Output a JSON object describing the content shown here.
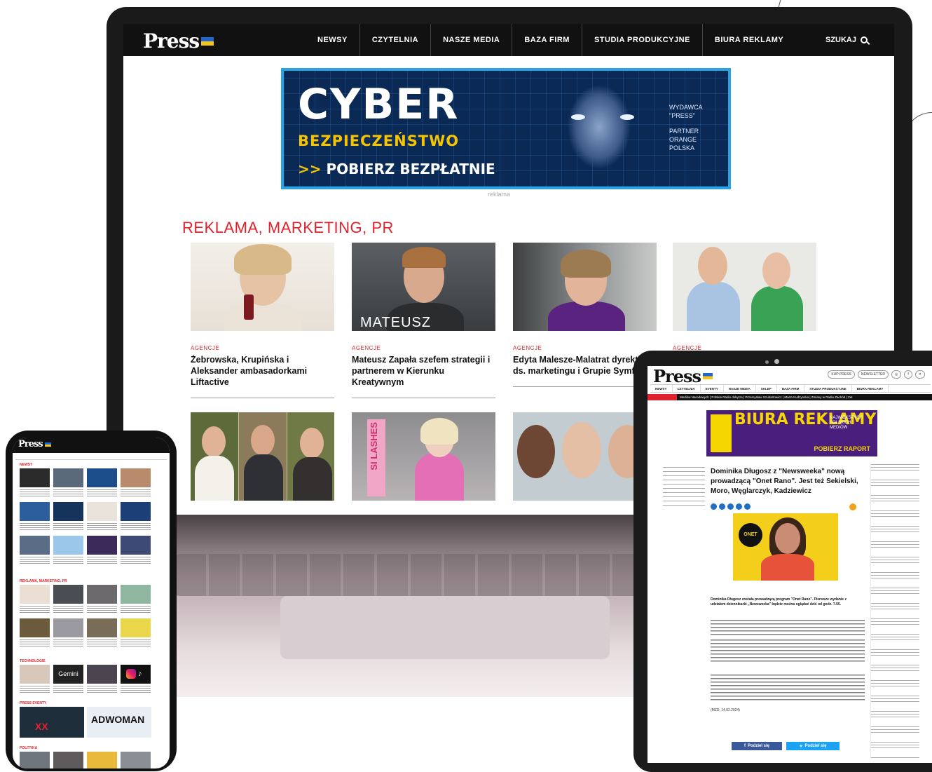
{
  "laptop": {
    "nav": {
      "logo": "Press",
      "items": [
        "NEWSY",
        "CZYTELNIA",
        "NASZE MEDIA",
        "BAZA FIRM",
        "STUDIA PRODUKCYJNE",
        "BIURA REKLAMY"
      ],
      "search_label": "SZUKAJ"
    },
    "ad": {
      "title": "CYBER",
      "subtitle": "BEZPIECZEŃSTWO",
      "cta_arrows": ">>",
      "cta": "POBIERZ BEZPŁATNIE",
      "side_lines": [
        "WYDAWCA",
        "\"PRESS\"",
        "",
        "PARTNER",
        "ORANGE",
        "POLSKA"
      ],
      "label": "reklama"
    },
    "section_title": "REKLAMA, MARKETING, PR",
    "cards_row1": [
      {
        "category": "AGENCJE",
        "headline": "Żebrowska, Krupińska i Aleksander ambasadorkami Liftactive"
      },
      {
        "category": "AGENCJE",
        "headline": "Mateusz Zapała szefem strategii i partnerem w Kierunku Kreatywnym",
        "image_text": "MATEUSZ"
      },
      {
        "category": "AGENCJE",
        "headline": "Edyta Malesze-Malatrat dyrektorką ds. marketingu i Grupie Symfonia"
      },
      {
        "category": "AGENCJE",
        "headline": ""
      }
    ],
    "cards_row2": [
      {
        "image_text": ""
      },
      {
        "image_text": "SI LASHES"
      },
      {
        "image_text": ""
      }
    ]
  },
  "phone": {
    "logo": "Press",
    "sections": [
      "NEWSY",
      "REKLAMA, MARKETING, PR",
      "TECHNOLOGIE",
      "PRESS EVENTY",
      "POLITYKA"
    ],
    "tiles": [
      "Gemini",
      "ADWOMAN"
    ]
  },
  "tablet": {
    "logo": "Press",
    "top_links": [
      "KUP PRESS",
      "NEWSLETTER"
    ],
    "nav": [
      "NEWSY",
      "CZYTELNIA",
      "EVENTY",
      "NASZE MEDIA",
      "SKLEP",
      "BAZA FIRM",
      "STUDIA PRODUKCYJNE",
      "BIURA REKLAMY"
    ],
    "ticker": "Mediów Narodowych | Polskie Radio dołącza | Przemysław Szubartowicz | Marta Kudzynska | Zmiany w Radiu Zachód | Zet",
    "ad": {
      "big": "BIURA REKLAMY",
      "small": "NAJWIĘKSZYCH POLSKICH MEDIÓW",
      "cta": "POBIERZ RAPORT"
    },
    "article": {
      "title": "Dominika Długosz z \"Newsweeka\" nową prowadzącą \"Onet Rano\". Jest też Sekielski, Moro, Węglarczyk, Kadziewicz",
      "lead": "Dominika Długosz została prowadzącą program \"Onet Rano\". Pierwsze wydanie z udziałem dziennikarki „Newsweeka\" będzie można oglądać dziś od godz. 7.55.",
      "image_badge": "ONET RANO",
      "date": "(MZD, 14.02.2024)"
    },
    "share": {
      "facebook": "Podziel się",
      "twitter": "Podziel się"
    }
  },
  "colors": {
    "accent": "#e0222c",
    "nav_bg": "#111111",
    "ad_blue": "#0a2a55",
    "ad_border": "#2aa3e0",
    "ad_yellow": "#f6c400"
  }
}
